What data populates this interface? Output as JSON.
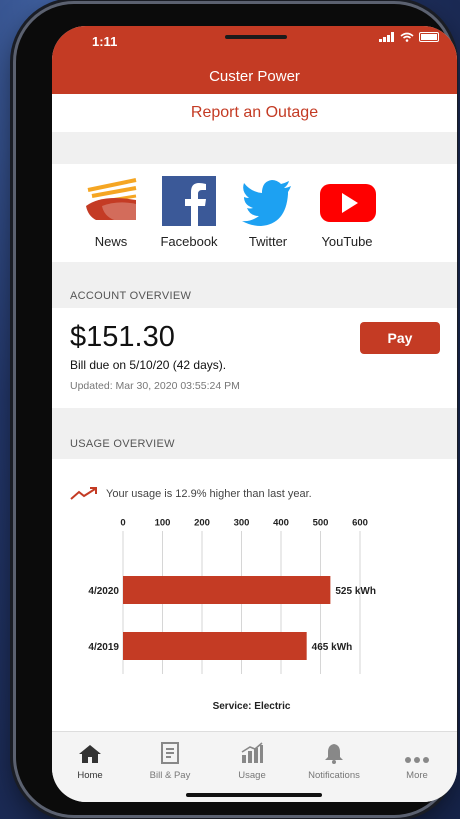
{
  "status_bar": {
    "time": "1:11"
  },
  "header": {
    "title": "Custer Power"
  },
  "outage": {
    "label": "Report an Outage"
  },
  "social": [
    {
      "label": "News",
      "icon": "news-sunrise-icon"
    },
    {
      "label": "Facebook",
      "icon": "facebook-icon"
    },
    {
      "label": "Twitter",
      "icon": "twitter-icon"
    },
    {
      "label": "YouTube",
      "icon": "youtube-icon"
    }
  ],
  "account": {
    "section_label": "ACCOUNT OVERVIEW",
    "amount": "$151.30",
    "due": "Bill due on 5/10/20 (42 days).",
    "updated": "Updated: Mar 30, 2020 03:55:24 PM",
    "pay_label": "Pay"
  },
  "usage": {
    "section_label": "USAGE OVERVIEW",
    "trend_text": "Your usage is 12.9% higher than last year."
  },
  "chart_data": {
    "type": "bar",
    "orientation": "horizontal",
    "categories": [
      "4/2020",
      "4/2019"
    ],
    "values": [
      525,
      465
    ],
    "value_labels": [
      "525 kWh",
      "465 kWh"
    ],
    "x_ticks": [
      0,
      100,
      200,
      300,
      400,
      500,
      600
    ],
    "xlim": [
      0,
      600
    ],
    "xlabel": "Service: Electric",
    "grid": true,
    "bar_color": "#c43b24"
  },
  "tabs": [
    {
      "label": "Home",
      "icon": "home-icon",
      "active": true
    },
    {
      "label": "Bill & Pay",
      "icon": "bill-icon",
      "active": false
    },
    {
      "label": "Usage",
      "icon": "usage-chart-icon",
      "active": false
    },
    {
      "label": "Notifications",
      "icon": "bell-icon",
      "active": false
    },
    {
      "label": "More",
      "icon": "more-dots-icon",
      "active": false
    }
  ],
  "colors": {
    "accent": "#c43b24",
    "facebook": "#3b5998",
    "twitter": "#1da1f2",
    "youtube": "#ff0000"
  }
}
